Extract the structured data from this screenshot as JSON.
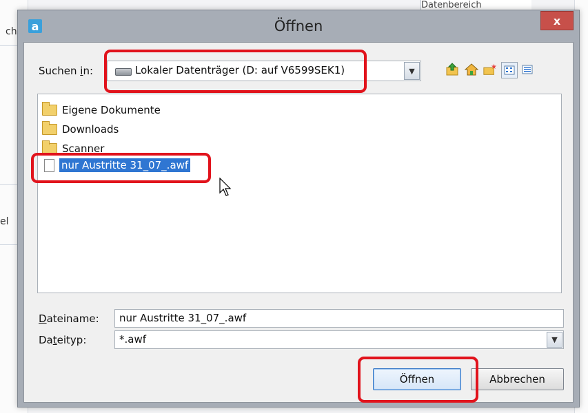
{
  "background": {
    "left_fragment_1": "ch",
    "left_fragment_2": "el",
    "top_fragment": "Datenbereich"
  },
  "dialog": {
    "title": "Öffnen",
    "app_icon_letter": "a",
    "close_label": "x",
    "lookin": {
      "label_prefix": "Suchen ",
      "label_underlined": "i",
      "label_suffix": "n:",
      "value": "Lokaler Datenträger (D: auf V6599SEK1)"
    },
    "toolbar": {
      "up_icon": "folder-up-icon",
      "home_icon": "home-icon",
      "new_folder_icon": "new-folder-icon",
      "list_view_icon": "list-view-icon",
      "details_view_icon": "details-view-icon"
    },
    "files": [
      {
        "name": "Eigene Dokumente",
        "type": "folder"
      },
      {
        "name": "Downloads",
        "type": "folder"
      },
      {
        "name": "Scanner",
        "type": "folder"
      },
      {
        "name": "nur Austritte 31_07_.awf",
        "type": "file",
        "selected": true
      }
    ],
    "filename": {
      "label_underlined": "D",
      "label_rest": "ateiname:",
      "value": "nur Austritte 31_07_.awf"
    },
    "filetype": {
      "label_prefix": "Da",
      "label_underlined": "t",
      "label_rest": "eityp:",
      "value": "*.awf"
    },
    "buttons": {
      "open": "Öffnen",
      "cancel": "Abbrechen"
    }
  },
  "colors": {
    "highlight": "#e1131c",
    "selection": "#2f76d2"
  }
}
